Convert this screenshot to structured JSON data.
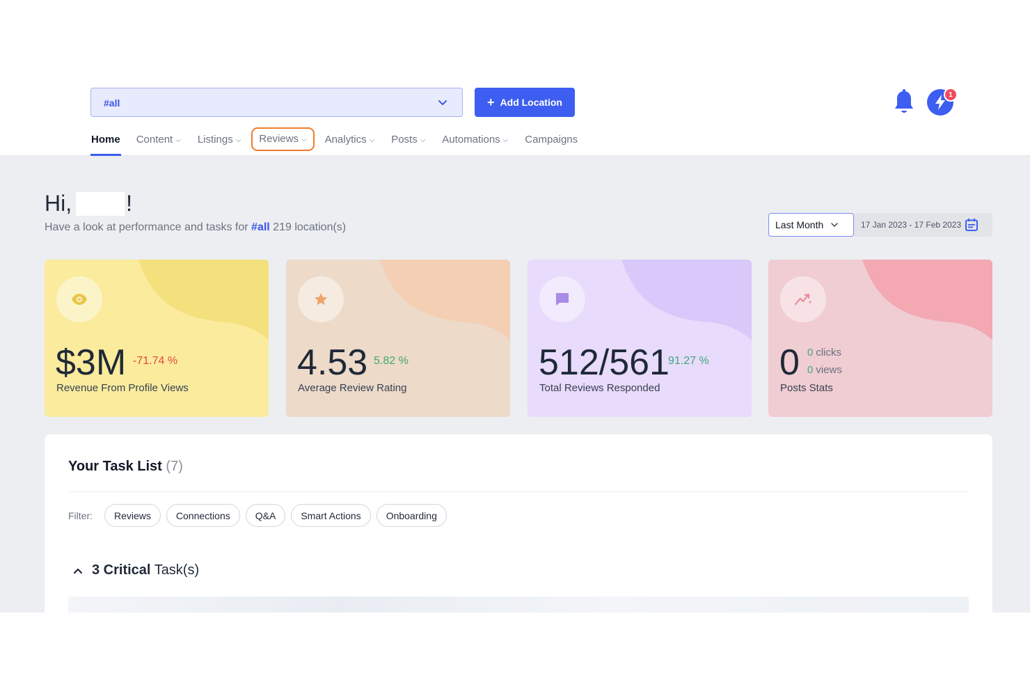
{
  "header": {
    "location_select": {
      "value": "#all"
    },
    "add_location_label": "Add Location",
    "notification_count": "1"
  },
  "nav": {
    "items": [
      {
        "label": "Home",
        "dropdown": false
      },
      {
        "label": "Content",
        "dropdown": true
      },
      {
        "label": "Listings",
        "dropdown": true
      },
      {
        "label": "Reviews",
        "dropdown": true
      },
      {
        "label": "Analytics",
        "dropdown": true
      },
      {
        "label": "Posts",
        "dropdown": true
      },
      {
        "label": "Automations",
        "dropdown": true
      },
      {
        "label": "Campaigns",
        "dropdown": false
      }
    ]
  },
  "greeting": {
    "hi": "Hi,",
    "exclaim": "!",
    "sub_prefix": "Have a look at performance and tasks for",
    "sub_tag": "#all",
    "sub_suffix": "219 location(s)"
  },
  "period": {
    "selected": "Last Month",
    "range": "17 Jan 2023 - 17 Feb 2023"
  },
  "cards": {
    "revenue": {
      "value": "$3M",
      "change": "-71.74 %",
      "label": "Revenue From Profile Views",
      "icon": "eye-icon",
      "change_color": "#e2483d"
    },
    "rating": {
      "value": "4.53",
      "change": "5.82 %",
      "label": "Average Review Rating",
      "icon": "star-icon",
      "change_color": "#3fa875"
    },
    "responded": {
      "value": "512/561",
      "change": "91.27 %",
      "label": "Total Reviews Responded",
      "icon": "chat-icon",
      "change_color": "#3fa875"
    },
    "posts": {
      "value": "0",
      "clicks_num": "0",
      "clicks_label": "clicks",
      "views_num": "0",
      "views_label": "views",
      "label": "Posts Stats",
      "icon": "trend-icon"
    }
  },
  "tasks": {
    "title": "Your Task List",
    "count": "(7)",
    "filter_label": "Filter:",
    "filters": [
      "Reviews",
      "Connections",
      "Q&A",
      "Smart Actions",
      "Onboarding"
    ],
    "critical_count": "3 Critical",
    "critical_suffix": "Task(s)"
  },
  "colors": {
    "accent": "#3d5ef0",
    "highlight_outline": "#f07c2a",
    "negative": "#e2483d",
    "positive": "#3fa875"
  }
}
